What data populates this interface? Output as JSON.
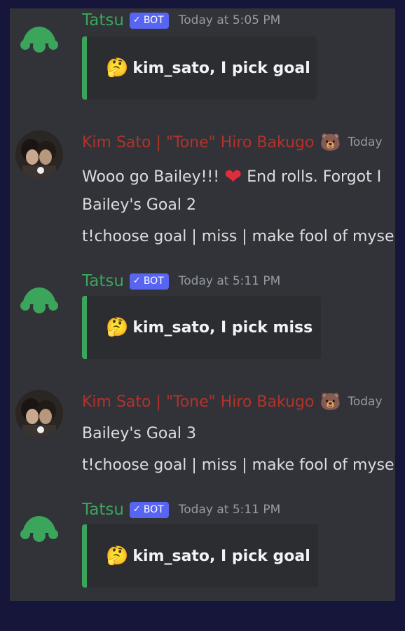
{
  "bot": {
    "name": "Tatsu",
    "badge": "BOT"
  },
  "user": {
    "name": "Kim Sato | \"Tone\" Hiro Bakugo",
    "badge_emoji": "🐻",
    "timestamp_partial": "Today"
  },
  "messages": [
    {
      "type": "bot",
      "timestamp": "Today at 5:05 PM",
      "embed_emoji": "🤔",
      "embed_text": "kim_sato, I pick goal"
    },
    {
      "type": "user",
      "lines": [
        "Wooo go Bailey!!!",
        "End rolls. Forgot I",
        "Bailey's Goal 2",
        "t!choose goal | miss | make fool of myse"
      ],
      "heart_emoji": "❤"
    },
    {
      "type": "bot",
      "timestamp": "Today at 5:11 PM",
      "embed_emoji": "🤔",
      "embed_text": "kim_sato, I pick miss"
    },
    {
      "type": "user",
      "lines": [
        "Bailey's Goal 3",
        "t!choose goal | miss | make fool of myse"
      ]
    },
    {
      "type": "bot",
      "timestamp": "Today at 5:11 PM",
      "embed_emoji": "🤔",
      "embed_text": "kim_sato, I pick goal"
    }
  ],
  "colors": {
    "bot_name": "#3ba55c",
    "user_name": "#b3322b",
    "badge": "#5865f2",
    "background": "#313338"
  }
}
